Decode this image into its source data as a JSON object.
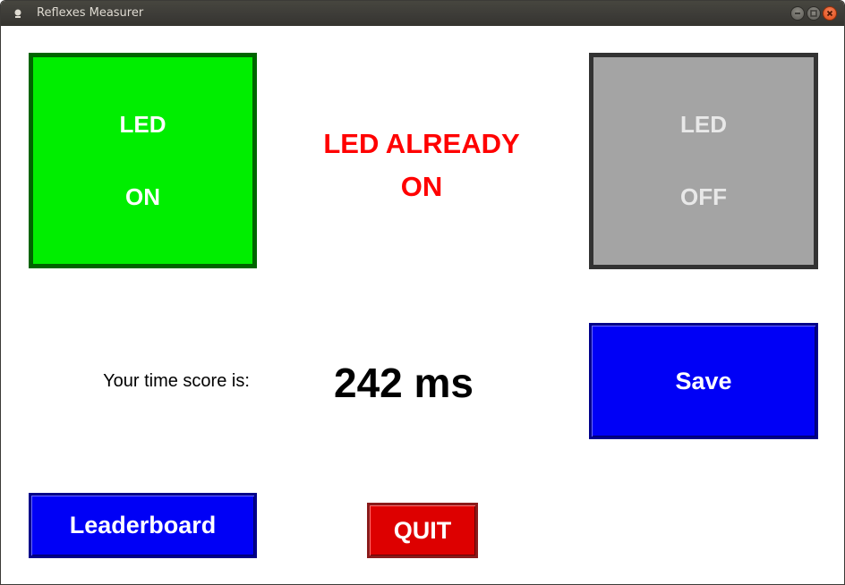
{
  "window": {
    "title": "Reflexes Measurer",
    "controls": [
      "minimize-icon",
      "maximize-icon",
      "close-icon"
    ]
  },
  "led_on": {
    "line1": "LED",
    "line2": "ON",
    "color": "#00ee00"
  },
  "led_off": {
    "line1": "LED",
    "line2": "OFF",
    "color": "#a4a4a4"
  },
  "status": {
    "line1": "LED ALREADY",
    "line2": "ON",
    "color": "#ff0000"
  },
  "score": {
    "label": "Your time score is:",
    "value": "242 ms"
  },
  "buttons": {
    "save": "Save",
    "leaderboard": "Leaderboard",
    "quit": "QUIT"
  },
  "colors": {
    "button_blue": "#0000f6",
    "button_red": "#dd0000"
  }
}
